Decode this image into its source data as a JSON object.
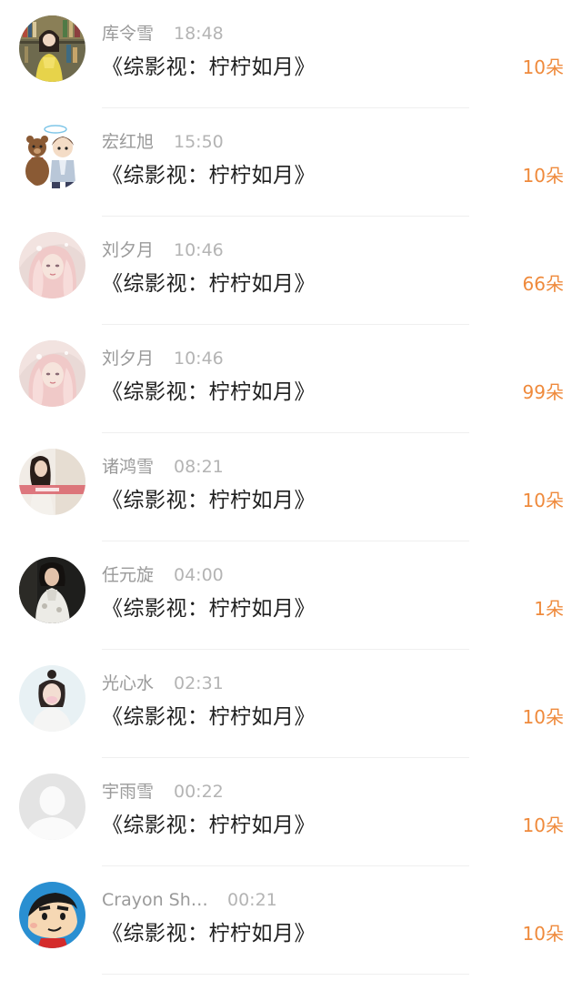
{
  "accent_color": "#ef8a3c",
  "gifts": [
    {
      "name": "库令雪",
      "time": "18:48",
      "title": "《综影视：柠柠如月》",
      "gift": "10朵",
      "avatar_icon": "avatar-photo-bookshelf-icon"
    },
    {
      "name": "宏红旭",
      "time": "15:50",
      "title": "《综影视：柠柠如月》",
      "gift": "10朵",
      "avatar_icon": "avatar-cartoon-bear-couple-icon"
    },
    {
      "name": "刘夕月",
      "time": "10:46",
      "title": "《综影视：柠柠如月》",
      "gift": "66朵",
      "avatar_icon": "avatar-pink-anime-girl-icon"
    },
    {
      "name": "刘夕月",
      "time": "10:46",
      "title": "《综影视：柠柠如月》",
      "gift": "99朵",
      "avatar_icon": "avatar-pink-anime-girl-icon"
    },
    {
      "name": "诸鸿雪",
      "time": "08:21",
      "title": "《综影视：柠柠如月》",
      "gift": "10朵",
      "avatar_icon": "avatar-photo-girl-icon"
    },
    {
      "name": "任元旋",
      "time": "04:00",
      "title": "《综影视：柠柠如月》",
      "gift": "1朵",
      "avatar_icon": "avatar-photo-woman-dark-icon"
    },
    {
      "name": "光心水",
      "time": "02:31",
      "title": "《综影视：柠柠如月》",
      "gift": "10朵",
      "avatar_icon": "avatar-photo-girl-light-icon"
    },
    {
      "name": "宇雨雪",
      "time": "00:22",
      "title": "《综影视：柠柠如月》",
      "gift": "10朵",
      "avatar_icon": "avatar-default-person-icon"
    },
    {
      "name": "Crayon Sh…",
      "time": "00:21",
      "title": "《综影视：柠柠如月》",
      "gift": "10朵",
      "avatar_icon": "avatar-crayon-shinchan-icon"
    }
  ]
}
